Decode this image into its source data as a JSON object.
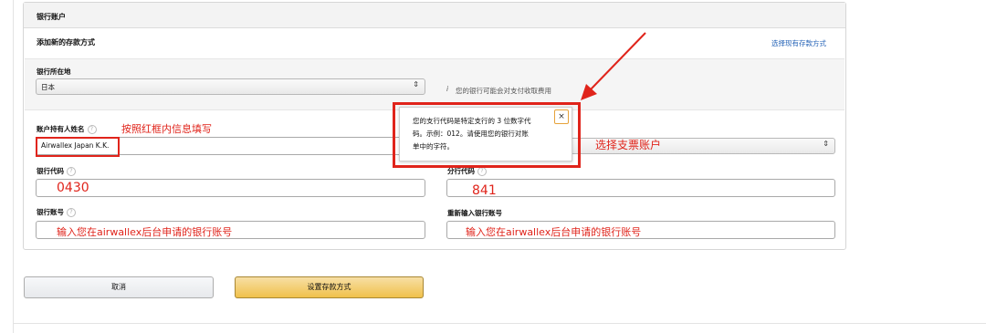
{
  "panel": {
    "header": "银行账户",
    "subheader": "添加新的存款方式",
    "choose_existing_link": "选择现有存款方式"
  },
  "region": {
    "label": "银行所在地",
    "value": "日本",
    "note_icon": "i",
    "note": "您的银行可能会对支付收取费用"
  },
  "account_holder": {
    "label": "账户持有人姓名",
    "value": "Airwallex Japan K.K.",
    "annotation": "按照红框内信息填写"
  },
  "account_type": {
    "annotation": "选择支票账户"
  },
  "tooltip": {
    "text_line1": "您的支行代码是特定支行的 3 位数字代",
    "text_line2": "码。示例：012。请使用您的银行对账",
    "text_line3": "单中的字符。",
    "close_label": "×"
  },
  "bank_code": {
    "label": "银行代码",
    "value": "0430"
  },
  "branch_code": {
    "label": "分行代码",
    "value": "841"
  },
  "account_number": {
    "label": "银行账号",
    "hint": "输入您在airwallex后台申请的银行账号"
  },
  "account_number_confirm": {
    "label": "重新输入银行账号",
    "hint": "输入您在airwallex后台申请的银行账号"
  },
  "buttons": {
    "cancel": "取消",
    "submit": "设置存款方式"
  },
  "colors": {
    "annotation_red": "#e0241b",
    "link_blue": "#1f5fb5",
    "submit_yellow": "#f0c14b"
  }
}
